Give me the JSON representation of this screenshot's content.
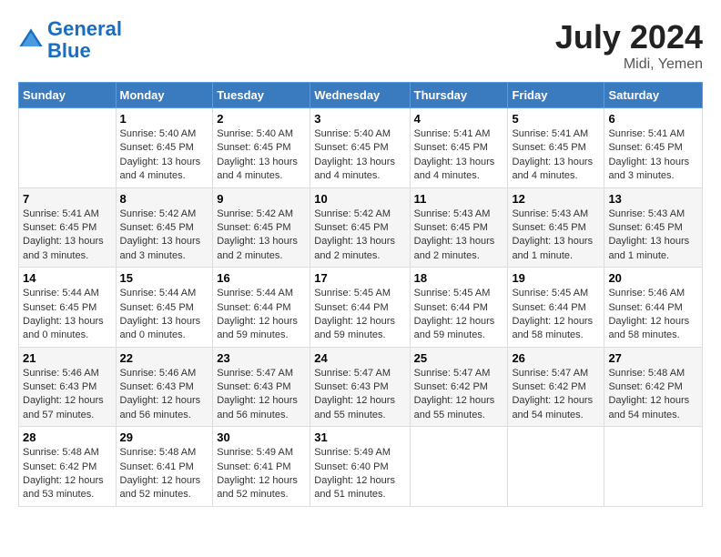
{
  "header": {
    "logo_general": "General",
    "logo_blue": "Blue",
    "month_year": "July 2024",
    "location": "Midi, Yemen"
  },
  "days_of_week": [
    "Sunday",
    "Monday",
    "Tuesday",
    "Wednesday",
    "Thursday",
    "Friday",
    "Saturday"
  ],
  "weeks": [
    [
      {
        "day": "",
        "sunrise": "",
        "sunset": "",
        "daylight": ""
      },
      {
        "day": "1",
        "sunrise": "Sunrise: 5:40 AM",
        "sunset": "Sunset: 6:45 PM",
        "daylight": "Daylight: 13 hours and 4 minutes."
      },
      {
        "day": "2",
        "sunrise": "Sunrise: 5:40 AM",
        "sunset": "Sunset: 6:45 PM",
        "daylight": "Daylight: 13 hours and 4 minutes."
      },
      {
        "day": "3",
        "sunrise": "Sunrise: 5:40 AM",
        "sunset": "Sunset: 6:45 PM",
        "daylight": "Daylight: 13 hours and 4 minutes."
      },
      {
        "day": "4",
        "sunrise": "Sunrise: 5:41 AM",
        "sunset": "Sunset: 6:45 PM",
        "daylight": "Daylight: 13 hours and 4 minutes."
      },
      {
        "day": "5",
        "sunrise": "Sunrise: 5:41 AM",
        "sunset": "Sunset: 6:45 PM",
        "daylight": "Daylight: 13 hours and 4 minutes."
      },
      {
        "day": "6",
        "sunrise": "Sunrise: 5:41 AM",
        "sunset": "Sunset: 6:45 PM",
        "daylight": "Daylight: 13 hours and 3 minutes."
      }
    ],
    [
      {
        "day": "7",
        "sunrise": "Sunrise: 5:41 AM",
        "sunset": "Sunset: 6:45 PM",
        "daylight": "Daylight: 13 hours and 3 minutes."
      },
      {
        "day": "8",
        "sunrise": "Sunrise: 5:42 AM",
        "sunset": "Sunset: 6:45 PM",
        "daylight": "Daylight: 13 hours and 3 minutes."
      },
      {
        "day": "9",
        "sunrise": "Sunrise: 5:42 AM",
        "sunset": "Sunset: 6:45 PM",
        "daylight": "Daylight: 13 hours and 2 minutes."
      },
      {
        "day": "10",
        "sunrise": "Sunrise: 5:42 AM",
        "sunset": "Sunset: 6:45 PM",
        "daylight": "Daylight: 13 hours and 2 minutes."
      },
      {
        "day": "11",
        "sunrise": "Sunrise: 5:43 AM",
        "sunset": "Sunset: 6:45 PM",
        "daylight": "Daylight: 13 hours and 2 minutes."
      },
      {
        "day": "12",
        "sunrise": "Sunrise: 5:43 AM",
        "sunset": "Sunset: 6:45 PM",
        "daylight": "Daylight: 13 hours and 1 minute."
      },
      {
        "day": "13",
        "sunrise": "Sunrise: 5:43 AM",
        "sunset": "Sunset: 6:45 PM",
        "daylight": "Daylight: 13 hours and 1 minute."
      }
    ],
    [
      {
        "day": "14",
        "sunrise": "Sunrise: 5:44 AM",
        "sunset": "Sunset: 6:45 PM",
        "daylight": "Daylight: 13 hours and 0 minutes."
      },
      {
        "day": "15",
        "sunrise": "Sunrise: 5:44 AM",
        "sunset": "Sunset: 6:45 PM",
        "daylight": "Daylight: 13 hours and 0 minutes."
      },
      {
        "day": "16",
        "sunrise": "Sunrise: 5:44 AM",
        "sunset": "Sunset: 6:44 PM",
        "daylight": "Daylight: 12 hours and 59 minutes."
      },
      {
        "day": "17",
        "sunrise": "Sunrise: 5:45 AM",
        "sunset": "Sunset: 6:44 PM",
        "daylight": "Daylight: 12 hours and 59 minutes."
      },
      {
        "day": "18",
        "sunrise": "Sunrise: 5:45 AM",
        "sunset": "Sunset: 6:44 PM",
        "daylight": "Daylight: 12 hours and 59 minutes."
      },
      {
        "day": "19",
        "sunrise": "Sunrise: 5:45 AM",
        "sunset": "Sunset: 6:44 PM",
        "daylight": "Daylight: 12 hours and 58 minutes."
      },
      {
        "day": "20",
        "sunrise": "Sunrise: 5:46 AM",
        "sunset": "Sunset: 6:44 PM",
        "daylight": "Daylight: 12 hours and 58 minutes."
      }
    ],
    [
      {
        "day": "21",
        "sunrise": "Sunrise: 5:46 AM",
        "sunset": "Sunset: 6:43 PM",
        "daylight": "Daylight: 12 hours and 57 minutes."
      },
      {
        "day": "22",
        "sunrise": "Sunrise: 5:46 AM",
        "sunset": "Sunset: 6:43 PM",
        "daylight": "Daylight: 12 hours and 56 minutes."
      },
      {
        "day": "23",
        "sunrise": "Sunrise: 5:47 AM",
        "sunset": "Sunset: 6:43 PM",
        "daylight": "Daylight: 12 hours and 56 minutes."
      },
      {
        "day": "24",
        "sunrise": "Sunrise: 5:47 AM",
        "sunset": "Sunset: 6:43 PM",
        "daylight": "Daylight: 12 hours and 55 minutes."
      },
      {
        "day": "25",
        "sunrise": "Sunrise: 5:47 AM",
        "sunset": "Sunset: 6:42 PM",
        "daylight": "Daylight: 12 hours and 55 minutes."
      },
      {
        "day": "26",
        "sunrise": "Sunrise: 5:47 AM",
        "sunset": "Sunset: 6:42 PM",
        "daylight": "Daylight: 12 hours and 54 minutes."
      },
      {
        "day": "27",
        "sunrise": "Sunrise: 5:48 AM",
        "sunset": "Sunset: 6:42 PM",
        "daylight": "Daylight: 12 hours and 54 minutes."
      }
    ],
    [
      {
        "day": "28",
        "sunrise": "Sunrise: 5:48 AM",
        "sunset": "Sunset: 6:42 PM",
        "daylight": "Daylight: 12 hours and 53 minutes."
      },
      {
        "day": "29",
        "sunrise": "Sunrise: 5:48 AM",
        "sunset": "Sunset: 6:41 PM",
        "daylight": "Daylight: 12 hours and 52 minutes."
      },
      {
        "day": "30",
        "sunrise": "Sunrise: 5:49 AM",
        "sunset": "Sunset: 6:41 PM",
        "daylight": "Daylight: 12 hours and 52 minutes."
      },
      {
        "day": "31",
        "sunrise": "Sunrise: 5:49 AM",
        "sunset": "Sunset: 6:40 PM",
        "daylight": "Daylight: 12 hours and 51 minutes."
      },
      {
        "day": "",
        "sunrise": "",
        "sunset": "",
        "daylight": ""
      },
      {
        "day": "",
        "sunrise": "",
        "sunset": "",
        "daylight": ""
      },
      {
        "day": "",
        "sunrise": "",
        "sunset": "",
        "daylight": ""
      }
    ]
  ]
}
